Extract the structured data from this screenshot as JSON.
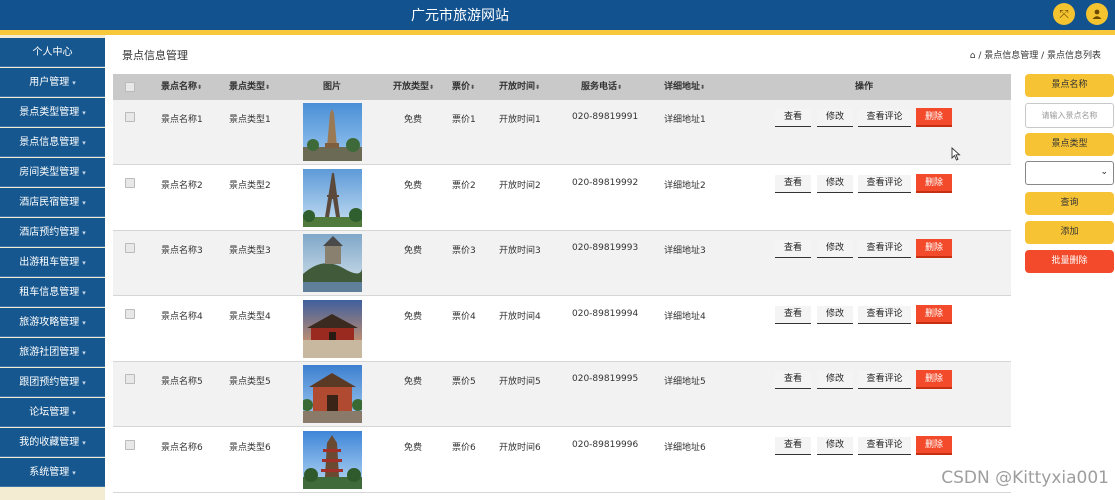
{
  "header": {
    "title": "广元市旅游网站",
    "icons": [
      "expand-icon",
      "user-icon"
    ]
  },
  "sidebar": {
    "items": [
      {
        "label": "个人中心"
      },
      {
        "label": "用户管理"
      },
      {
        "label": "景点类型管理"
      },
      {
        "label": "景点信息管理"
      },
      {
        "label": "房间类型管理"
      },
      {
        "label": "酒店民宿管理"
      },
      {
        "label": "酒店预约管理"
      },
      {
        "label": "出游租车管理"
      },
      {
        "label": "租车信息管理"
      },
      {
        "label": "旅游攻略管理"
      },
      {
        "label": "旅游社团管理"
      },
      {
        "label": "跟团预约管理"
      },
      {
        "label": "论坛管理"
      },
      {
        "label": "我的收藏管理"
      },
      {
        "label": "系统管理"
      }
    ]
  },
  "page": {
    "title": "景点信息管理",
    "breadcrumb": "/ 景点信息管理 / 景点信息列表"
  },
  "table": {
    "headers": {
      "name": "景点名称",
      "type": "景点类型",
      "image": "图片",
      "open_type": "开放类型",
      "price": "票价",
      "open_time": "开放时间",
      "phone": "服务电话",
      "address": "详细地址",
      "actions": "操作"
    },
    "actions": {
      "view": "查看",
      "edit": "修改",
      "comments": "查看评论",
      "delete": "删除"
    },
    "rows": [
      {
        "name": "景点名称1",
        "type": "景点类型1",
        "open_type": "免费",
        "price": "票价1",
        "open_time": "开放时间1",
        "phone": "020-89819991",
        "address": "详细地址1",
        "image": "tower-pagoda"
      },
      {
        "name": "景点名称2",
        "type": "景点类型2",
        "open_type": "免费",
        "price": "票价2",
        "open_time": "开放时间2",
        "phone": "020-89819992",
        "address": "详细地址2",
        "image": "eiffel-tower"
      },
      {
        "name": "景点名称3",
        "type": "景点类型3",
        "open_type": "免费",
        "price": "票价3",
        "open_time": "开放时间3",
        "phone": "020-89819993",
        "address": "详细地址3",
        "image": "castle-on-hill"
      },
      {
        "name": "景点名称4",
        "type": "景点类型4",
        "open_type": "免费",
        "price": "票价4",
        "open_time": "开放时间4",
        "phone": "020-89819994",
        "address": "详细地址4",
        "image": "palace-gate-sunset"
      },
      {
        "name": "景点名称5",
        "type": "景点类型5",
        "open_type": "免费",
        "price": "票价5",
        "open_time": "开放时间5",
        "phone": "020-89819995",
        "address": "详细地址5",
        "image": "temple-gate"
      },
      {
        "name": "景点名称6",
        "type": "景点类型6",
        "open_type": "免费",
        "price": "票价6",
        "open_time": "开放时间6",
        "phone": "020-89819996",
        "address": "详细地址6",
        "image": "pagoda-tower"
      }
    ]
  },
  "search_panel": {
    "name_label": "景点名称",
    "name_placeholder": "请输入景点名称",
    "type_label": "景点类型",
    "type_selected": "",
    "search_btn": "查询",
    "add_btn": "添加",
    "batch_delete_btn": "批量删除"
  },
  "watermark": "CSDN @Kittyxia001",
  "colors": {
    "header": "#12528f",
    "accent": "#f6c335",
    "danger": "#f24a2a",
    "sidebar": "#16578f"
  }
}
